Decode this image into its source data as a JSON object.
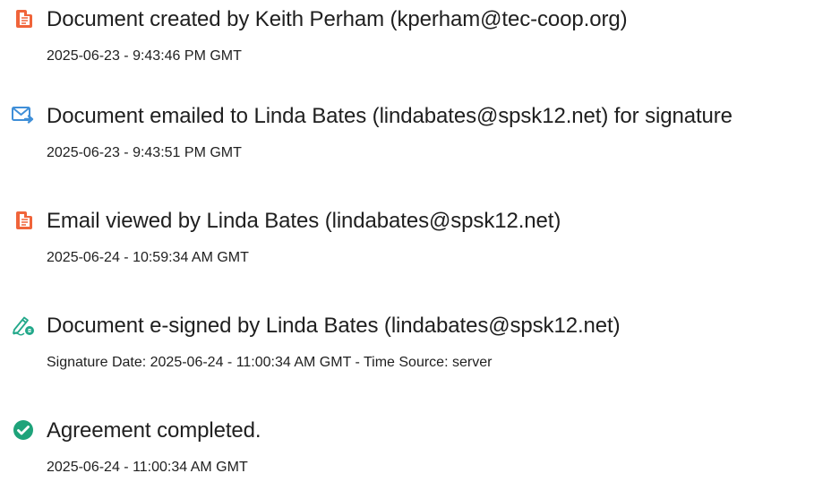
{
  "events": [
    {
      "icon": "acrobat-document-icon",
      "title": "Document created by Keith Perham (kperham@tec-coop.org)",
      "meta": "2025-06-23 - 9:43:46 PM GMT"
    },
    {
      "icon": "email-sent-icon",
      "title": "Document emailed to Linda Bates (lindabates@spsk12.net) for signature",
      "meta": "2025-06-23 - 9:43:51 PM GMT"
    },
    {
      "icon": "acrobat-document-icon",
      "title": "Email viewed by Linda Bates (lindabates@spsk12.net)",
      "meta": "2025-06-24 - 10:59:34 AM GMT"
    },
    {
      "icon": "e-sign-pen-icon",
      "title": "Document e-signed by Linda Bates (lindabates@spsk12.net)",
      "meta": "Signature Date: 2025-06-24 - 11:00:34 AM GMT - Time Source: server"
    },
    {
      "icon": "check-circle-icon",
      "title": "Agreement completed.",
      "meta": "2025-06-24 - 11:00:34 AM GMT"
    }
  ],
  "colors": {
    "acrobat_red": "#f0643a",
    "email_blue": "#3f8fd8",
    "sign_green": "#22a88a",
    "check_green": "#1ea37a",
    "text": "#1f1f1f"
  }
}
